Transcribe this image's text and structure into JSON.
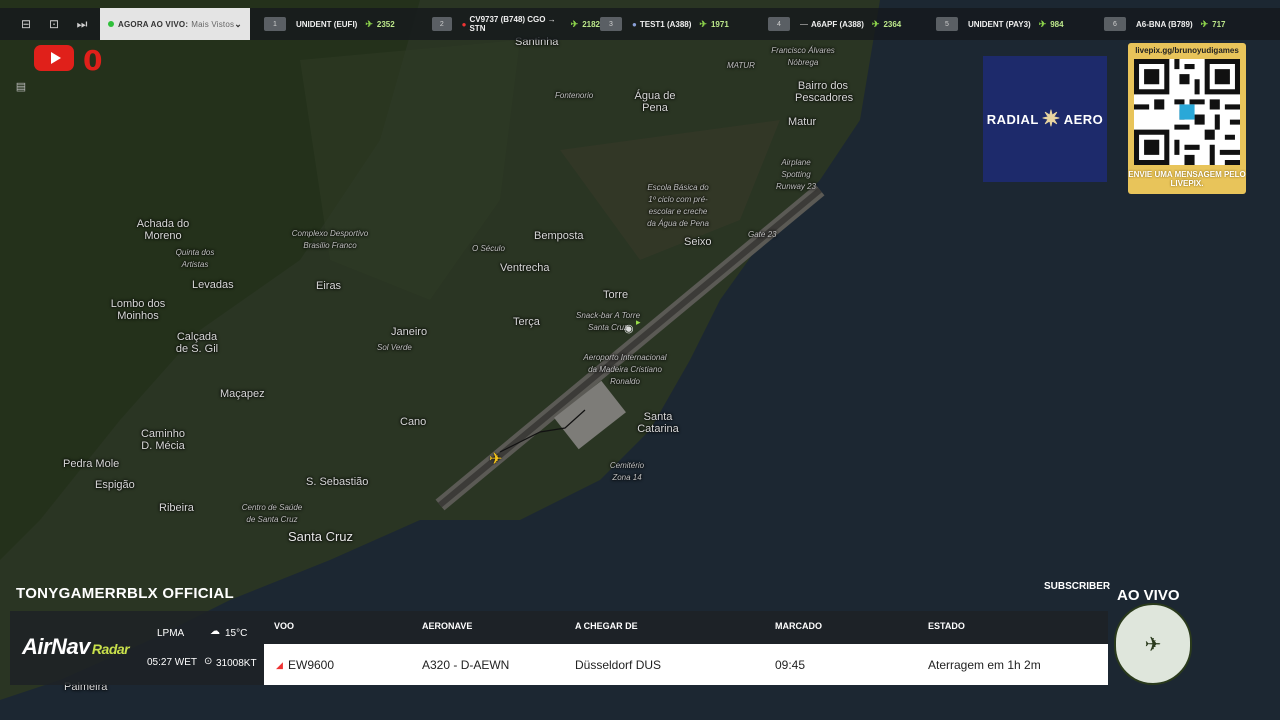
{
  "topbar": {
    "now_label": "AGORA AO VIVO:",
    "now_sub": "Mais Vistos",
    "flights": [
      {
        "rank": "1",
        "name": "UNIDENT (EUFI)",
        "count": "2352"
      },
      {
        "rank": "2",
        "name": "CV9737 (B748) CGO → STN",
        "count": "2182"
      },
      {
        "rank": "3",
        "name": "TEST1 (A388)",
        "count": "1971"
      },
      {
        "rank": "4",
        "name": "A6APF (A388)",
        "count": "2364"
      },
      {
        "rank": "5",
        "name": "UNIDENT (PAY3)",
        "count": "984"
      },
      {
        "rank": "6",
        "name": "A6-BNA (B789)",
        "count": "717"
      }
    ]
  },
  "youtube_count": "0",
  "map_places": [
    {
      "label": "Santinha"
    },
    {
      "label": "Fontenorio"
    },
    {
      "label": "Água de Pena"
    },
    {
      "label": "Francisco Álvares Nóbrega"
    },
    {
      "label": "MATUR"
    },
    {
      "label": "Bairro dos Pescadores"
    },
    {
      "label": "Matur"
    },
    {
      "label": "Airplane Spotting Runway 23"
    },
    {
      "label": "Escola Básica do 1º ciclo com pré-escolar e creche da Água de Pena"
    },
    {
      "label": "Bemposta"
    },
    {
      "label": "Seixo"
    },
    {
      "label": "Gate 23"
    },
    {
      "label": "Achada do Moreno"
    },
    {
      "label": "Complexo Desportivo Brasilio Franco"
    },
    {
      "label": "Quinta dos Artistas"
    },
    {
      "label": "Ventrecha"
    },
    {
      "label": "O Século"
    },
    {
      "label": "Levadas"
    },
    {
      "label": "Eiras"
    },
    {
      "label": "Torre"
    },
    {
      "label": "Lombo dos Moinhos"
    },
    {
      "label": "Terça"
    },
    {
      "label": "Snack-bar A Torre Santa Cruz"
    },
    {
      "label": "Calçada de S. Gil"
    },
    {
      "label": "Janeiro"
    },
    {
      "label": "Sol Verde"
    },
    {
      "label": "Aeroporto Internacional da Madeira Cristiano Ronaldo"
    },
    {
      "label": "Maçapez"
    },
    {
      "label": "Santa Catarina"
    },
    {
      "label": "Cano"
    },
    {
      "label": "Caminho D. Mécia"
    },
    {
      "label": "Pedra Mole"
    },
    {
      "label": "Espigão"
    },
    {
      "label": "S. Sebastião"
    },
    {
      "label": "Cemitério Zona 14"
    },
    {
      "label": "Ribeira"
    },
    {
      "label": "Centro de Saúde de Santa Cruz"
    },
    {
      "label": "Santa Cruz"
    },
    {
      "label": "Palmeira"
    }
  ],
  "ads": {
    "radial_left": "RADIAL",
    "radial_right": "AERO",
    "qr_url": "livepix.gg/brunoyudigames",
    "qr_message": "ENVIE UMA MENSAGEM PELO LIVEPIX."
  },
  "channel_name": "TONYGAMERRBLX OFFICIAL",
  "subscriber_label": "SUBSCRIBER",
  "live_label": "AO VIVO",
  "panel": {
    "brand": "AirNav",
    "brand_sub": "Radar",
    "airport": "LPMA",
    "time": "05:27 WET",
    "temp": "15°C",
    "wind": "31008KT",
    "headers": {
      "flight": "VOO",
      "aircraft": "AERONAVE",
      "from": "A CHEGAR DE",
      "scheduled": "MARCADO",
      "status": "ESTADO"
    },
    "row": {
      "flight": "EW9600",
      "aircraft": "A320 - D-AEWN",
      "from": "Düsseldorf DUS",
      "scheduled": "09:45",
      "status": "Aterragem em 1h 2m"
    }
  },
  "colors": {
    "accent": "#8bd14a",
    "youtube": "#e0201a",
    "radial_bg": "#1d2a6b",
    "qr_bg": "#e8c45a"
  }
}
